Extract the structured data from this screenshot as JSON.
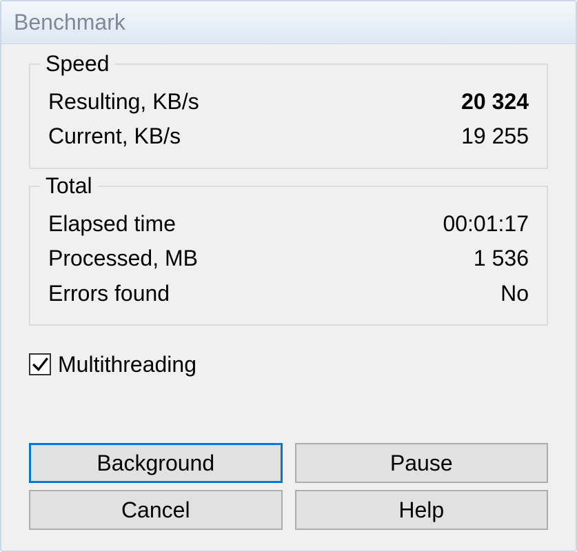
{
  "window": {
    "title": "Benchmark"
  },
  "speed": {
    "legend": "Speed",
    "resulting_label": "Resulting, KB/s",
    "resulting_value": "20 324",
    "current_label": "Current, KB/s",
    "current_value": "19 255"
  },
  "total": {
    "legend": "Total",
    "elapsed_label": "Elapsed time",
    "elapsed_value": "00:01:17",
    "processed_label": "Processed, MB",
    "processed_value": "1 536",
    "errors_label": "Errors found",
    "errors_value": "No"
  },
  "options": {
    "multithreading_label": "Multithreading",
    "multithreading_checked": true
  },
  "buttons": {
    "background": "Background",
    "pause": "Pause",
    "cancel": "Cancel",
    "help": "Help"
  }
}
